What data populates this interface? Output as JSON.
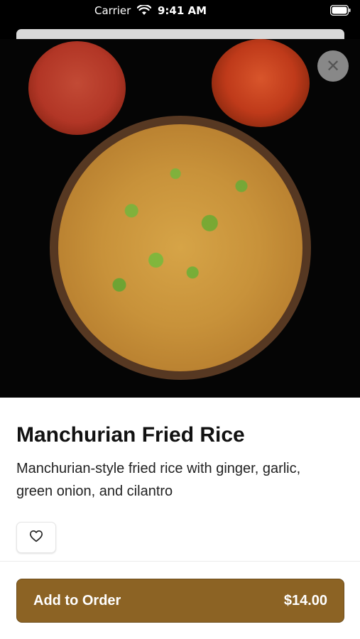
{
  "status_bar": {
    "carrier": "Carrier",
    "time": "9:41 AM"
  },
  "hero": {
    "close_icon": "close-icon"
  },
  "item": {
    "title": "Manchurian Fried Rice",
    "description": "Manchurian-style fried rice with ginger, garlic, green onion, and cilantro"
  },
  "actions": {
    "favorite_icon": "heart-icon",
    "add_label": "Add to Order",
    "price": "$14.00"
  },
  "colors": {
    "accent": "#8c6324",
    "background": "#ffffff",
    "title": "#111111"
  }
}
